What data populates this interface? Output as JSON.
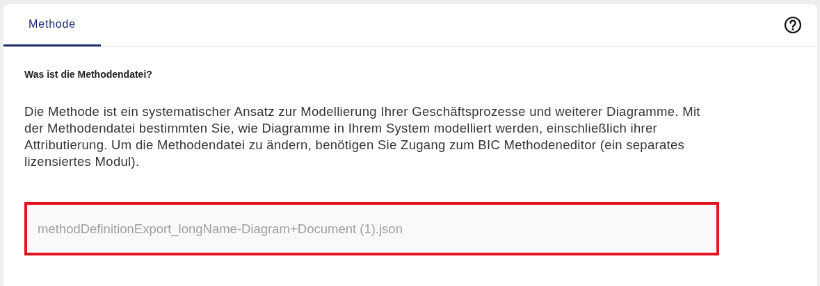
{
  "tabs": [
    {
      "label": "Methode",
      "selected": true
    }
  ],
  "heading": "Was ist die Methodendatei?",
  "description": "Die Methode ist ein systematischer Ansatz zur Modellierung Ihrer Geschäftsprozesse und weiterer Diagramme. Mit der Methodendatei bestimmten Sie, wie Diagramme in Ihrem System modelliert werden, einschließlich ihrer Attributierung. Um die Methodendatei zu ändern, benötigen Sie Zugang zum BIC Methodeneditor (ein separates lizensiertes Modul).",
  "file_field": {
    "value": "methodDefinitionExport_longName-Diagram+Document (1).json",
    "highlighted": true
  }
}
